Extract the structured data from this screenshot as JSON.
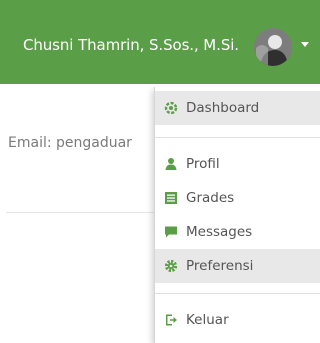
{
  "header": {
    "user_name": "Chusni Thamrin, S.Sos., M.Si.",
    "accent_color": "#5b9e48",
    "avatar_icon": "user-avatar",
    "dropdown_icon": "caret-down-icon"
  },
  "main": {
    "email_text": "Email: pengaduar"
  },
  "user_menu": {
    "items": [
      {
        "label": "Dashboard",
        "icon": "dashboard-icon",
        "active": true
      },
      {
        "label": "Profil",
        "icon": "user-icon",
        "active": false
      },
      {
        "label": "Grades",
        "icon": "grades-icon",
        "active": false
      },
      {
        "label": "Messages",
        "icon": "messages-icon",
        "active": false
      },
      {
        "label": "Preferensi",
        "icon": "gear-icon",
        "active": true
      },
      {
        "label": "Keluar",
        "icon": "logout-icon",
        "active": false
      }
    ]
  }
}
